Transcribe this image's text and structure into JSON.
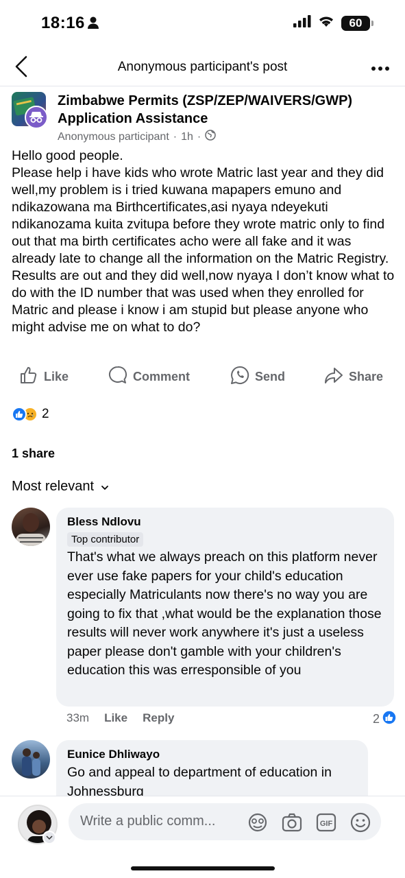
{
  "status_bar": {
    "time": "18:16",
    "battery": "60"
  },
  "nav": {
    "title": "Anonymous participant's post"
  },
  "post": {
    "group_name": "Zimbabwe Permits (ZSP/ZEP/WAIVERS/GWP) Application Assistance",
    "author": "Anonymous participant",
    "time": "1h",
    "body": [
      "Hello good people.",
      "Please help i have kids who wrote Matric last year and they did well,my problem is i tried kuwana mapapers emuno and ndikazowana ma Birthcertificates,asi nyaya ndeyekuti ndikanozama kuita zvitupa before they wrote matric only to find out that ma birth certificates acho were all fake and it was already late to change all the information on the Matric Registry.",
      "Results are out and they did well,now nyaya I don’t know what to do with the ID number that was used when they enrolled for Matric and please i know i am stupid but please anyone who might advise me on what to do?"
    ],
    "reaction_count": "2",
    "shares": "1 share"
  },
  "actions": {
    "like": "Like",
    "comment": "Comment",
    "send": "Send",
    "share": "Share"
  },
  "sort_label": "Most relevant",
  "comments": [
    {
      "name": "Bless Ndlovu",
      "badge": "Top contributor",
      "text": "That's what we always preach on this platform never ever use fake papers for your child's education especially Matriculants now there's no way you are going to fix that ,what would be the explanation those results will never work anywhere it's just a useless paper please don't gamble with your children's education this was erresponsible of you",
      "time": "33m",
      "like": "Like",
      "reply": "Reply",
      "likes": "2"
    },
    {
      "name": "Eunice Dhliwayo",
      "text": "Go and appeal to department of education in Johnessburg"
    }
  ],
  "composer": {
    "placeholder": "Write a public comm..."
  },
  "colors": {
    "accent": "#1877f2",
    "secondary_text": "#65676b",
    "bubble": "#f0f2f5"
  }
}
